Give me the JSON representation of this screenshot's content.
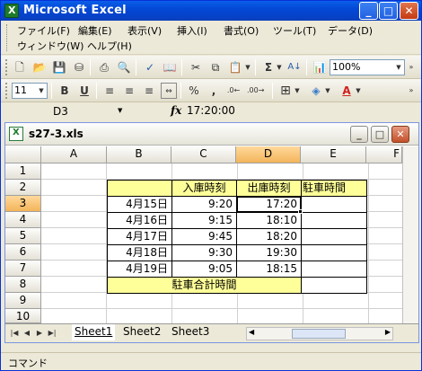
{
  "window": {
    "title": "Microsoft Excel",
    "buttons": {
      "minimize": "_",
      "maximize": "□",
      "close": "✕"
    }
  },
  "menu": {
    "row1": [
      "ファイル(F)",
      "編集(E)",
      "表示(V)",
      "挿入(I)",
      "書式(O)",
      "ツール(T)",
      "データ(D)"
    ],
    "row2": [
      "ウィンドウ(W)",
      "ヘルプ(H)"
    ]
  },
  "toolbar": {
    "zoom": "100%",
    "font_size": "11",
    "bold": "B",
    "underline": "U",
    "sigma": "Σ",
    "percent": "%",
    "comma": ","
  },
  "formula_bar": {
    "name_box": "D3",
    "fx": "fx",
    "formula": "17:20:00"
  },
  "workbook": {
    "filename": "s27-3.xls",
    "columns": [
      "A",
      "B",
      "C",
      "D",
      "E",
      "F"
    ],
    "rows": [
      "1",
      "2",
      "3",
      "4",
      "5",
      "6",
      "7",
      "8",
      "9",
      "10"
    ],
    "header_row": {
      "c": "入庫時刻",
      "d": "出庫時刻",
      "e": "駐車時間"
    },
    "data": [
      {
        "date": "4月15日",
        "in": "9:20",
        "out": "17:20"
      },
      {
        "date": "4月16日",
        "in": "9:15",
        "out": "18:10"
      },
      {
        "date": "4月17日",
        "in": "9:45",
        "out": "18:20"
      },
      {
        "date": "4月18日",
        "in": "9:30",
        "out": "19:30"
      },
      {
        "date": "4月19日",
        "in": "9:05",
        "out": "18:15"
      }
    ],
    "total_label": "駐車合計時間",
    "sheets": [
      "Sheet1",
      "Sheet2",
      "Sheet3"
    ]
  },
  "status": {
    "mode": "コマンド"
  },
  "colors": {
    "title_blue": "#0348d6",
    "cell_yellow": "#ffff99",
    "header_selected": "#f3b45a"
  }
}
